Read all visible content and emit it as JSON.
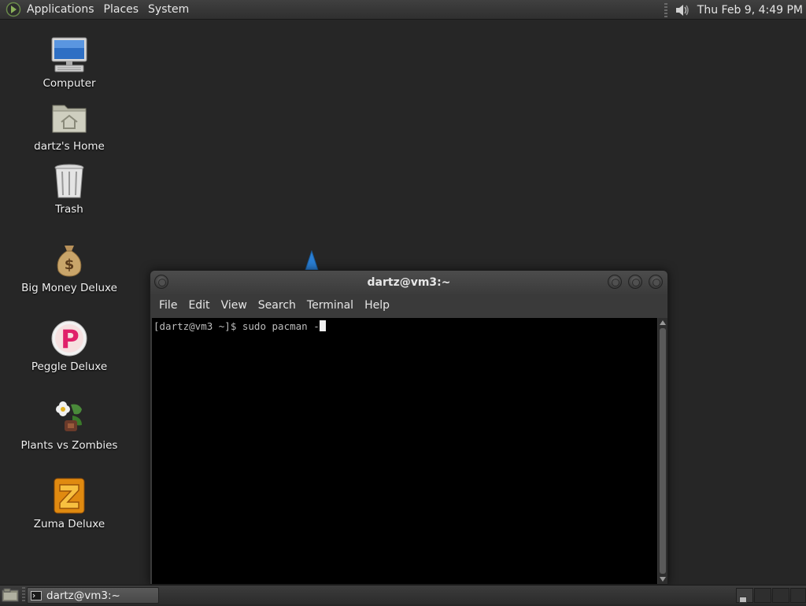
{
  "top_panel": {
    "menus": [
      "Applications",
      "Places",
      "System"
    ],
    "clock": "Thu Feb  9,  4:49 PM",
    "launcher_icon": "gnome-foot-icon",
    "volume_icon": "speaker-icon"
  },
  "desktop_icons": [
    {
      "label": "Computer",
      "icon": "computer-icon"
    },
    {
      "label": "dartz's Home",
      "icon": "home-folder-icon"
    },
    {
      "label": "Trash",
      "icon": "trash-icon"
    },
    {
      "label": "Big Money Deluxe",
      "icon": "money-bag-icon"
    },
    {
      "label": "Peggle Deluxe",
      "icon": "peggle-icon"
    },
    {
      "label": "Plants vs Zombies",
      "icon": "plants-vs-zombies-icon"
    },
    {
      "label": "Zuma Deluxe",
      "icon": "zuma-icon"
    }
  ],
  "terminal": {
    "title": "dartz@vm3:~",
    "menu": [
      "File",
      "Edit",
      "View",
      "Search",
      "Terminal",
      "Help"
    ],
    "prompt_line": "[dartz@vm3 ~]$ sudo pacman -"
  },
  "taskbar": {
    "task_label": "dartz@vm3:~",
    "task_icon": "terminal-icon",
    "show_desktop_icon": "show-desktop-icon"
  },
  "colors": {
    "desktop_bg": "#262626",
    "panel": "#3a3a3a",
    "terminal_bg": "#000000",
    "terminal_fg": "#bdbdbd"
  }
}
